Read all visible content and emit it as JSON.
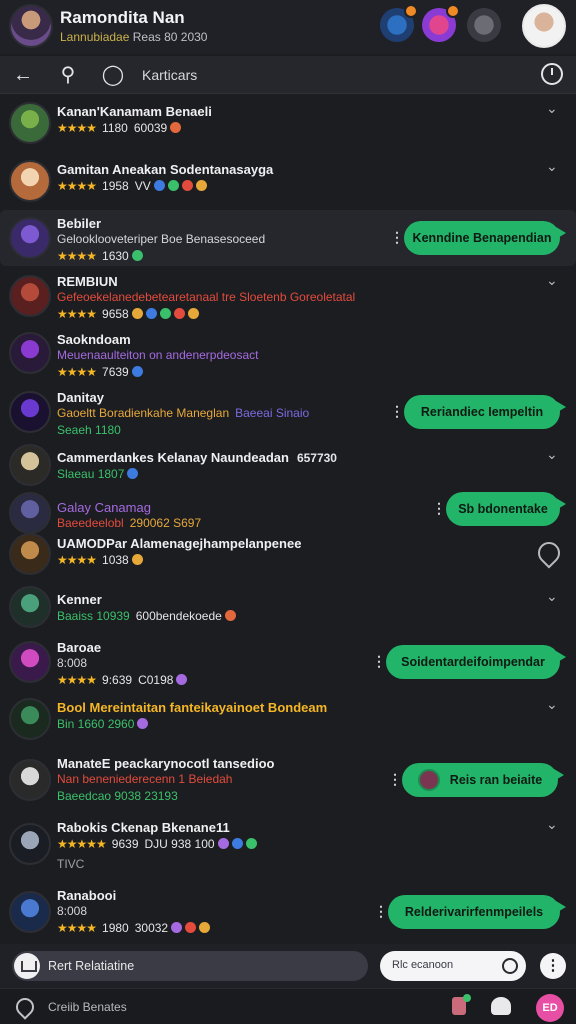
{
  "header": {
    "title": "Ramondita Nan",
    "subtitle_accent": "Lannubiadae",
    "subtitle_rest": "Reas 80 2030",
    "icons": [
      "shield-icon",
      "game-icon",
      "ghost-icon"
    ],
    "accent": "#22b56a"
  },
  "toolbar": {
    "title": "Karticars"
  },
  "rows": [
    {
      "name": "Kanan'Kanamam Benaeli",
      "stars": "★★★★",
      "meta": "1180",
      "meta2": "60039",
      "dots": [
        "#e3683c"
      ],
      "chevron": true
    },
    {
      "name": "Gamitan Aneakan Sodentanasayga",
      "stars": "★★★★",
      "meta": "1958",
      "meta2": "VV",
      "dots": [
        "#3d7be0",
        "#3ac06a",
        "#e34b3c",
        "#e7a83a"
      ],
      "chevron": true
    },
    {
      "name": "Bebiler",
      "line2": "Gelooklooveteriper Boe Benasesoceed",
      "stars": "★★★★",
      "meta": "1630",
      "dots": [
        "#3ac06a"
      ],
      "pill": "Kenndine Benapendian"
    },
    {
      "name": "REMBIUN",
      "line2": "Gefeoekelanedebetearetanaal tre Sloetenb Goreoletatal",
      "stars": "★★★★",
      "meta": "9658",
      "dots": [
        "#e7a83a",
        "#3d7be0",
        "#3ac06a",
        "#e34b3c",
        "#e7a83a"
      ],
      "chevron": true
    },
    {
      "name": "Saokndoam",
      "line2": "Meuenaaulteiton on andenerpdeosact",
      "stars": "★★★★",
      "meta": "7639",
      "dots": [
        "#3d7be0"
      ]
    },
    {
      "name": "Danitay",
      "line2": "Gaoeltt Boradienkahe Maneglan",
      "line2b": "Baeeai Sinaio",
      "stars": "",
      "meta": "Seaeh 1180",
      "pill": "Reriandiec Iempeltin"
    },
    {
      "name": "Cammerdankes Kelanay Naundeadan",
      "meta2": "657730",
      "stars": "",
      "meta": "Slaeau 1807",
      "dots": [
        "#3d7be0"
      ],
      "chevron": true
    },
    {
      "name": "Galay Canamag",
      "line2": "Baeedeelobl",
      "meta2": "290062 S697",
      "pill": "Sb bdonentake"
    },
    {
      "name": "UAMODPar Alamenagejhampelanpenee",
      "stars": "★★★★",
      "meta": "1038",
      "dots": [
        "#e7a83a"
      ]
    },
    {
      "name": "Kenner",
      "stars": "",
      "meta": "Baaiss 10939",
      "meta2": "600bendekoede",
      "dots": [
        "#e3683c"
      ],
      "chevron": true
    },
    {
      "name": "Baroae",
      "line2": "8:008",
      "stars": "★★★★",
      "meta": "9:639",
      "meta2": "C0198",
      "dots": [
        "#a56ae0"
      ],
      "pill": "Soidentardeifoimpendar"
    },
    {
      "name": "Bool Mereintaitan fanteikayainoet Bondeam",
      "stars": "",
      "meta": "Bin 1660 2960",
      "dots": [
        "#a56ae0"
      ],
      "chevron": true
    },
    {
      "name": "ManateE peackarynocotl tansedioo",
      "line2": "Nan beneniederecenn 1 Beiedah",
      "stars": "",
      "meta": "Baeedcao 9038 23193",
      "pill": "Reis ran beiaite"
    },
    {
      "name": "Rabokis Ckenap Bkenane11",
      "stars": "★★★★★",
      "meta": "9639",
      "meta2": "DJU 938 100",
      "dots": [
        "#a56ae0",
        "#3d7be0",
        "#3ac06a"
      ],
      "chevron": true,
      "extra": "TIVC"
    },
    {
      "name": "Ranabooi",
      "line2": "8:008",
      "stars": "★★★★",
      "meta": "1980",
      "meta2": "30032",
      "dots": [
        "#a56ae0",
        "#e34b3c",
        "#e7a83a"
      ],
      "pill": "Relderivarirfenmpeilels"
    }
  ],
  "compose": {
    "left_label": "Rert Relatiatine",
    "search_placeholder": "Rlc ecanoon"
  },
  "statusbar": {
    "label": "Creiib Benates",
    "badge": "ED"
  }
}
